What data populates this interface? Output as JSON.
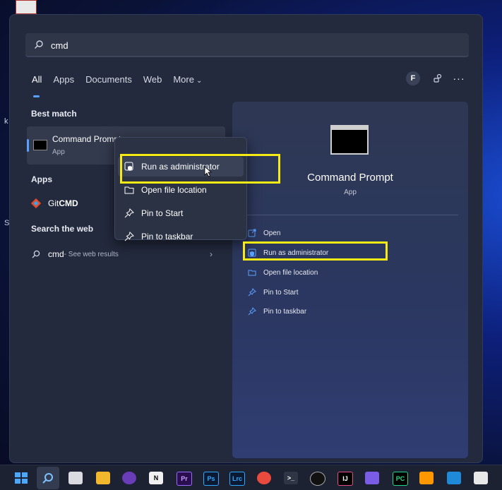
{
  "search": {
    "value": "cmd"
  },
  "tabs": [
    {
      "label": "All"
    },
    {
      "label": "Apps"
    },
    {
      "label": "Documents"
    },
    {
      "label": "Web"
    },
    {
      "label": "More"
    }
  ],
  "account_initial": "F",
  "sections": {
    "best_match": "Best match",
    "apps": "Apps",
    "search_web": "Search the web"
  },
  "best_match": {
    "title": "Command Prompt",
    "type": "App"
  },
  "apps_list": [
    {
      "label_plain": "Git ",
      "label_bold": "CMD"
    }
  ],
  "web_result": {
    "query": "cmd",
    "suffix": " - See web results"
  },
  "context_menu": [
    {
      "label": "Run as administrator",
      "icon": "shield-icon"
    },
    {
      "label": "Open file location",
      "icon": "folder-icon"
    },
    {
      "label": "Pin to Start",
      "icon": "pin-icon"
    },
    {
      "label": "Pin to taskbar",
      "icon": "pin-icon"
    }
  ],
  "detail": {
    "title": "Command Prompt",
    "subtitle": "App",
    "actions": [
      {
        "label": "Open",
        "icon": "open-icon"
      },
      {
        "label": "Run as administrator",
        "icon": "shield-icon"
      },
      {
        "label": "Open file location",
        "icon": "folder-icon"
      },
      {
        "label": "Pin to Start",
        "icon": "pin-icon"
      },
      {
        "label": "Pin to taskbar",
        "icon": "pin-icon"
      }
    ]
  },
  "taskbar": {
    "premiere": "Pr",
    "photoshop": "Ps",
    "lightroom": "Lrc",
    "pycharm": "PC",
    "intellij": "IJ",
    "notion": "N"
  },
  "colors": {
    "highlight": "#f5ea14",
    "accent": "#5aa0ff"
  }
}
